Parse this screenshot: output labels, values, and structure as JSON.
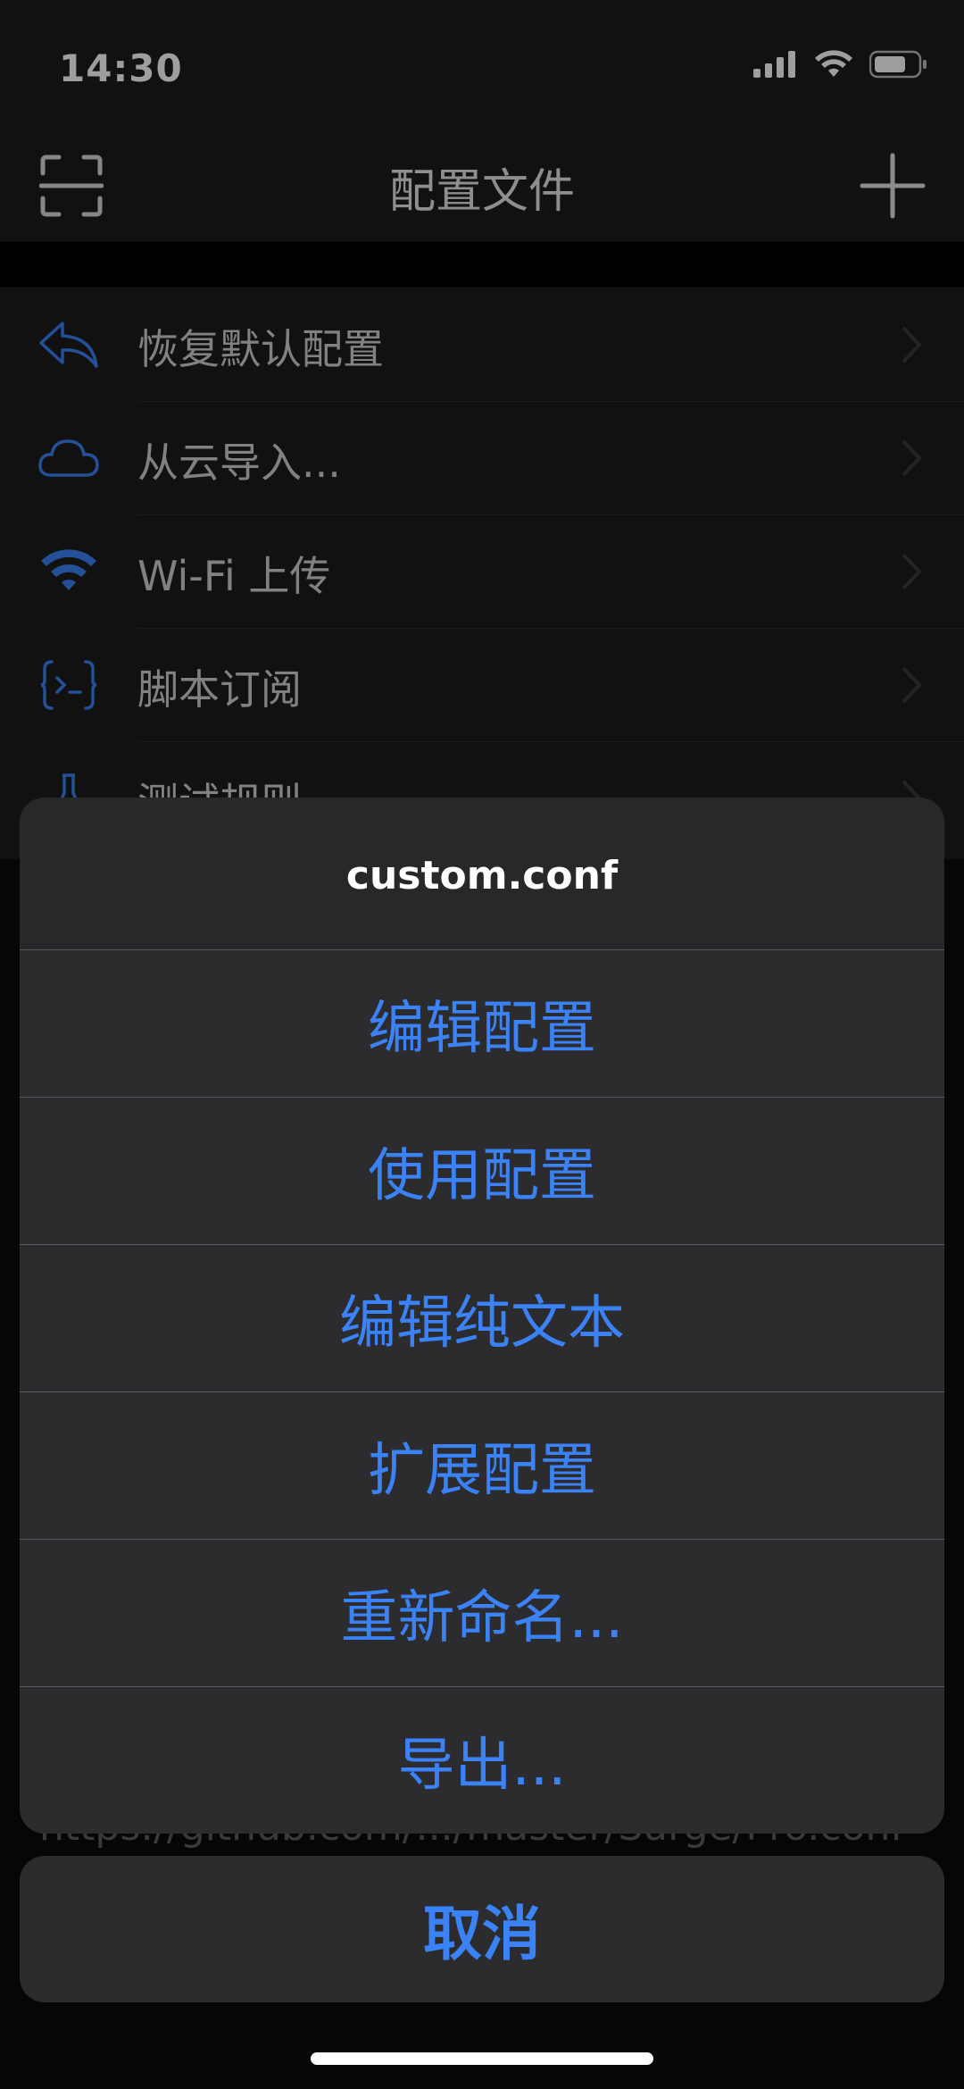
{
  "status_bar": {
    "time": "14:30"
  },
  "nav": {
    "title": "配置文件",
    "left_icon": "scan-icon",
    "right_icon": "plus-icon"
  },
  "list": {
    "items": [
      {
        "label": "恢复默认配置",
        "icon": "reply-arrow-icon"
      },
      {
        "label": "从云导入...",
        "icon": "cloud-icon"
      },
      {
        "label": "Wi-Fi 上传",
        "icon": "wifi-icon"
      },
      {
        "label": "脚本订阅",
        "icon": "script-braces-icon"
      },
      {
        "label": "测试规则",
        "icon": "flask-icon"
      }
    ]
  },
  "background": {
    "url_text": "https://github.com/.../master/Surge/Pro.conf"
  },
  "action_sheet": {
    "title": "custom.conf",
    "actions": [
      "编辑配置",
      "使用配置",
      "编辑纯文本",
      "扩展配置",
      "重新命名...",
      "导出..."
    ],
    "cancel": "取消"
  },
  "colors": {
    "accent": "#3b82f6",
    "sheet_bg": "#2c2c2e",
    "page_bg": "#1c1c1e"
  }
}
